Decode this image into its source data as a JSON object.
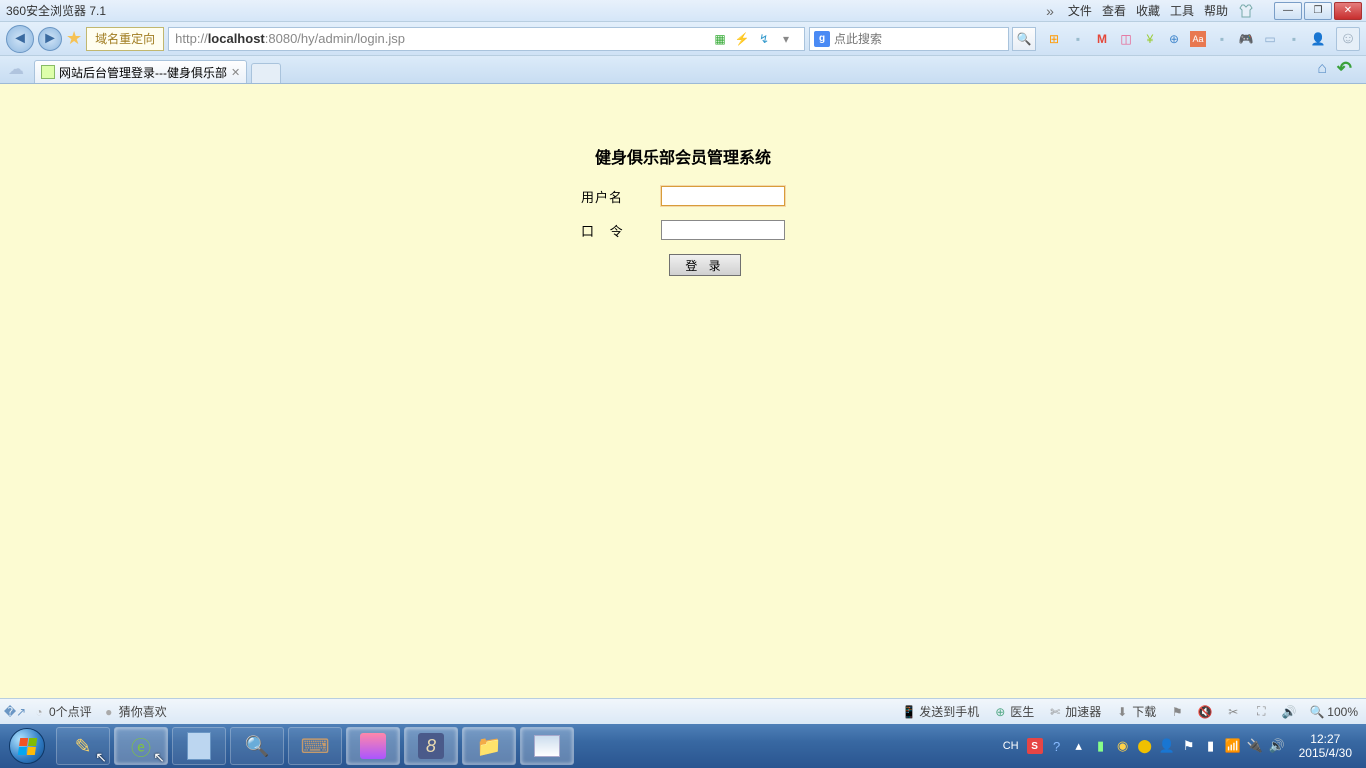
{
  "titlebar": {
    "title": "360安全浏览器 7.1",
    "menus": [
      "文件",
      "查看",
      "收藏",
      "工具",
      "帮助"
    ]
  },
  "navbar": {
    "redirect_label": "域名重定向",
    "url_pre": "http://",
    "url_host": "localhost",
    "url_post": ":8080/hy/admin/login.jsp",
    "search_placeholder": "点此搜索"
  },
  "tabbar": {
    "tab_title": "网站后台管理登录---健身俱乐部"
  },
  "page": {
    "title": "健身俱乐部会员管理系统",
    "username_label": "用户名",
    "password_label": "口 令",
    "login_btn": "登 录"
  },
  "statusbar": {
    "comments": "0个点评",
    "guess": "猜你喜欢",
    "send_phone": "发送到手机",
    "doctor": "医生",
    "accelerator": "加速器",
    "download": "下载",
    "zoom": "100%"
  },
  "taskbar": {
    "ime": "CH",
    "time": "12:27",
    "date": "2015/4/30"
  }
}
